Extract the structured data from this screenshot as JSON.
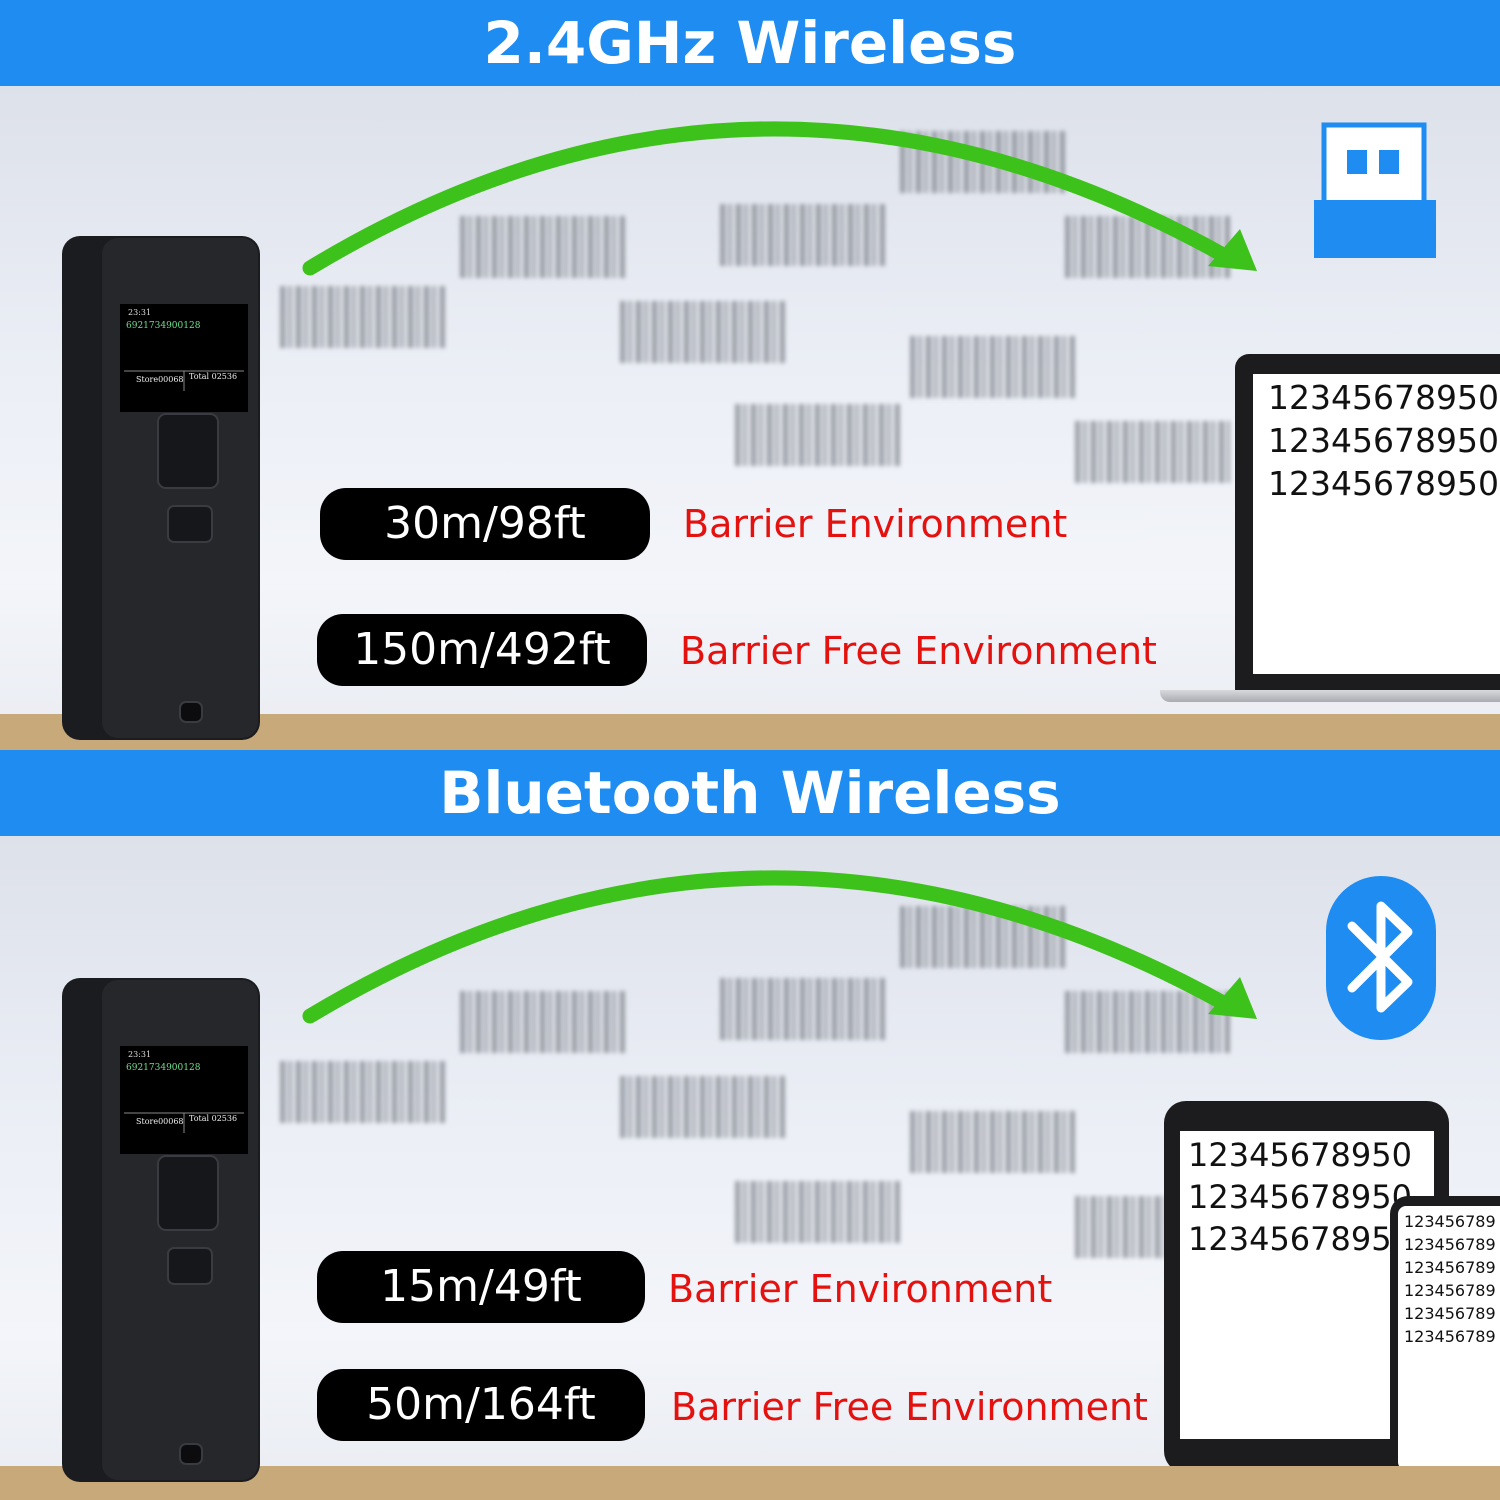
{
  "section_wireless": {
    "title": "2.4GHz Wireless",
    "ranges": [
      {
        "distance": "30m/98ft",
        "environment": "Barrier Environment"
      },
      {
        "distance": "150m/492ft",
        "environment": "Barrier Free Environment"
      }
    ],
    "scanner_screen": {
      "time": "23:31",
      "code": "6921734900128",
      "store": "Store00068",
      "total": "Total 02536"
    },
    "laptop_lines": [
      "12345678950",
      "12345678950",
      "12345678950"
    ],
    "receiver_icon": "usb-dongle-icon"
  },
  "section_bluetooth": {
    "title": "Bluetooth Wireless",
    "ranges": [
      {
        "distance": "15m/49ft",
        "environment": "Barrier Environment"
      },
      {
        "distance": "50m/164ft",
        "environment": "Barrier Free Environment"
      }
    ],
    "scanner_screen": {
      "time": "23:31",
      "code": "6921734900128",
      "store": "Store00068",
      "total": "Total 02536"
    },
    "tablet_lines": [
      "12345678950",
      "12345678950",
      "12345678950"
    ],
    "phone_lines": [
      "123456789",
      "123456789",
      "123456789",
      "123456789",
      "123456789",
      "123456789"
    ],
    "receiver_icon": "bluetooth-icon"
  },
  "colors": {
    "banner": "#1e8cf0",
    "arrow": "#3dc21b",
    "range_text": "#e4110f",
    "shelf": "#c8a97a"
  }
}
